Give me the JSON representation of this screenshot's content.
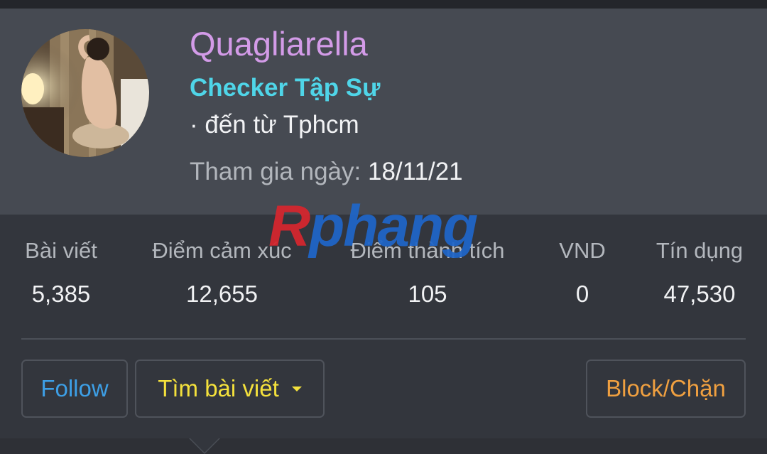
{
  "profile": {
    "username": "Quagliarella",
    "title": "Checker Tập Sự",
    "location": "· đến từ Tphcm",
    "joined_label": "Tham gia ngày:",
    "joined_value": "18/11/21",
    "avatar": "profile-photo"
  },
  "watermark": {
    "first": "R",
    "rest": "phang"
  },
  "stats": [
    {
      "label": "Bài viết",
      "value": "5,385"
    },
    {
      "label": "Điểm cảm xúc",
      "value": "12,655"
    },
    {
      "label": "Điểm thành tích",
      "value": "105"
    },
    {
      "label": "VND",
      "value": "0"
    },
    {
      "label": "Tín dụng",
      "value": "47,530"
    }
  ],
  "actions": {
    "follow": "Follow",
    "find_posts": "Tìm bài viết",
    "block": "Block/Chặn"
  },
  "colors": {
    "username": "#d39be8",
    "title": "#4fd5e8",
    "follow": "#3d9fe6",
    "find_posts": "#f4e13c",
    "block": "#f0a040",
    "header_bg": "#464a52",
    "body_bg": "#33363d"
  }
}
